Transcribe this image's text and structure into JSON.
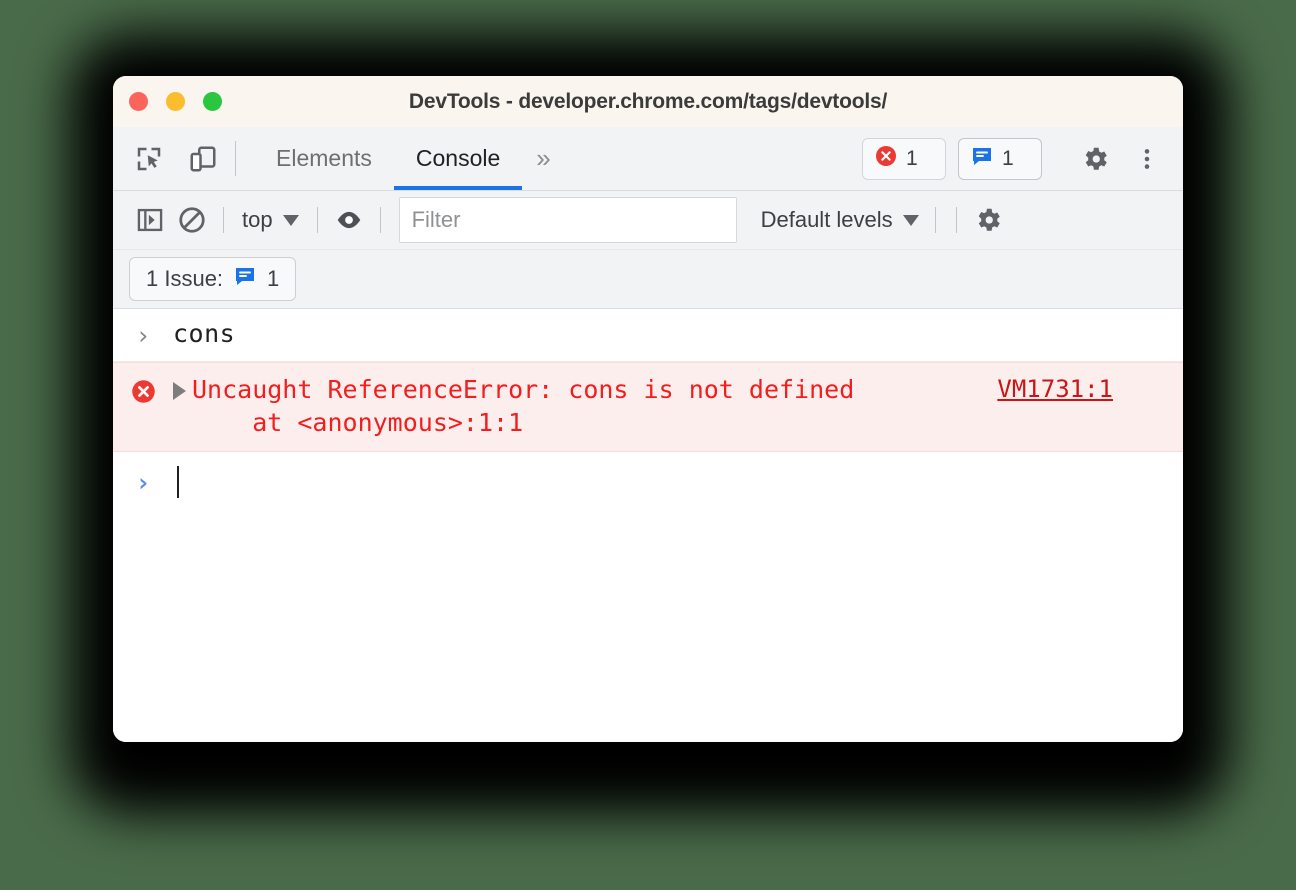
{
  "window": {
    "title": "DevTools - developer.chrome.com/tags/devtools/",
    "traffic_lights": [
      "close",
      "minimize",
      "maximize"
    ]
  },
  "tabbar": {
    "inspect_icon": "inspect-element-icon",
    "device_icon": "device-toolbar-icon",
    "tabs": [
      {
        "label": "Elements",
        "active": false
      },
      {
        "label": "Console",
        "active": true
      }
    ],
    "more_tabs_label": "»",
    "error_count": "1",
    "issue_count": "1",
    "settings_icon": "gear-icon",
    "more_icon": "kebab-menu-icon"
  },
  "console_toolbar": {
    "sidebar_icon": "console-sidebar-icon",
    "clear_icon": "clear-console-icon",
    "context_value": "top",
    "eye_icon": "live-expression-eye-icon",
    "filter_placeholder": "Filter",
    "filter_value": "",
    "levels_value": "Default levels",
    "settings_icon": "console-settings-gear-icon"
  },
  "issues_bar": {
    "label": "1 Issue:",
    "count": "1",
    "icon": "issue-bubble-icon"
  },
  "console": {
    "entries": [
      {
        "type": "input",
        "prompt": "›",
        "text": "cons"
      },
      {
        "type": "error",
        "icon": "error-circle-icon",
        "message": "Uncaught ReferenceError: cons is not defined\n    at <anonymous>:1:1",
        "source_link": "VM1731:1"
      },
      {
        "type": "prompt",
        "prompt": "›",
        "text": ""
      }
    ]
  },
  "colors": {
    "accent_blue": "#1a73e8",
    "error_red": "#f21d1d",
    "error_bg": "#fdeeee",
    "issue_blue": "#1a73e8",
    "toolbar_bg": "#f1f3f4",
    "titlebar_bg": "#faf5ee",
    "page_bg": "#4a6b4a"
  }
}
